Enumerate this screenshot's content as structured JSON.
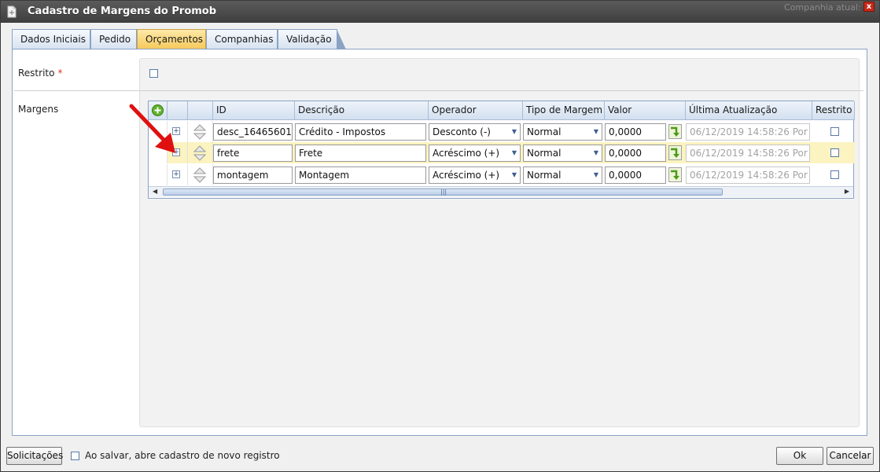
{
  "window": {
    "title": "Cadastro de Margens do Promob",
    "background_text": "Companhia atual:",
    "close_label": "x"
  },
  "tabs": [
    "Dados Iniciais",
    "Pedido",
    "Orçamentos",
    "Companhias",
    "Validação"
  ],
  "active_tab": "Orçamentos",
  "form": {
    "restrito_label": "Restrito",
    "required_mark": "*",
    "margens_label": "Margens"
  },
  "grid": {
    "columns": [
      "ID",
      "Descrição",
      "Operador",
      "Tipo de Margem",
      "Valor",
      "Última Atualização",
      "Restrito"
    ],
    "rows": [
      {
        "id": "desc_16465601",
        "descricao": "Crédito - Impostos",
        "operador": "Desconto (-)",
        "tipo": "Normal",
        "valor": "0,0000",
        "atualizacao": "06/12/2019 14:58:26 Por",
        "restrito": false
      },
      {
        "id": "frete",
        "descricao": "Frete",
        "operador": "Acréscimo (+)",
        "tipo": "Normal",
        "valor": "0,0000",
        "atualizacao": "06/12/2019 14:58:26 Por",
        "restrito": false
      },
      {
        "id": "montagem",
        "descricao": "Montagem",
        "operador": "Acréscimo (+)",
        "tipo": "Normal",
        "valor": "0,0000",
        "atualizacao": "06/12/2019 14:58:26 Por",
        "restrito": false
      }
    ],
    "selected_row": 1
  },
  "footer": {
    "solicitacoes_label": "Solicitações",
    "new_record_label": "Ao salvar, abre cadastro de novo registro",
    "ok_label": "Ok",
    "cancel_label": "Cancelar"
  },
  "colors": {
    "accent": "#f5c85a",
    "border": "#8aa3c4",
    "selected_row": "#fbf3c0",
    "annotation_arrow": "#e01010"
  },
  "icons": [
    "page-icon",
    "close-icon",
    "add-icon",
    "expand-icon",
    "sort-arrows-icon",
    "apply-arrow-icon",
    "dropdown-arrow-icon"
  ]
}
